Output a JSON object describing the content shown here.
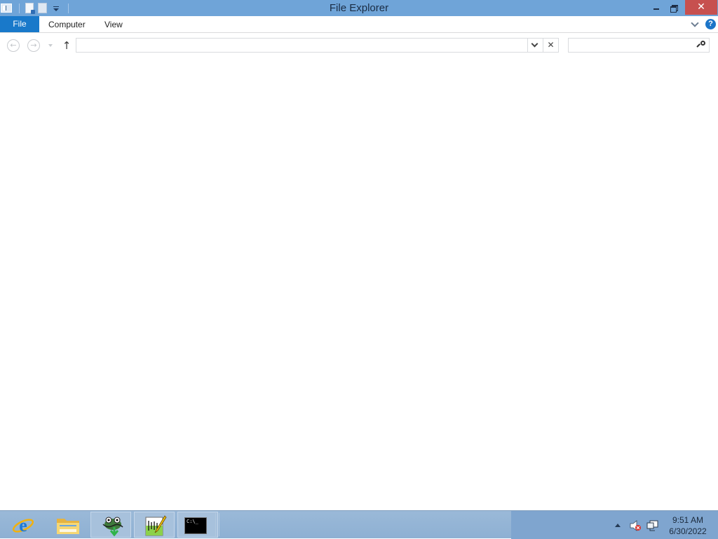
{
  "window": {
    "title": "File Explorer",
    "close_glyph": "✕"
  },
  "ribbon": {
    "tabs": [
      {
        "label": "File"
      },
      {
        "label": "Computer"
      },
      {
        "label": "View"
      }
    ],
    "help_glyph": "?"
  },
  "navigation": {
    "back_glyph": "←",
    "forward_glyph": "→",
    "up_glyph": "↑",
    "address_value": "",
    "clear_glyph": "✕",
    "search_value": "",
    "search_placeholder": ""
  },
  "taskbar": {
    "items": [
      {
        "name": "Internet Explorer",
        "icon": "internet-explorer-icon",
        "state": "pinned"
      },
      {
        "name": "File Explorer",
        "icon": "file-explorer-icon",
        "state": "pinned"
      },
      {
        "name": "Wireshark",
        "icon": "wireshark-icon",
        "state": "running"
      },
      {
        "name": "Notepad++",
        "icon": "notepad-icon",
        "state": "running"
      },
      {
        "name": "Command Prompt",
        "icon": "command-prompt-icon",
        "state": "running",
        "icon_text": "C:\\_"
      }
    ],
    "tray": {
      "time": "9:51 AM",
      "date": "6/30/2022"
    }
  },
  "colors": {
    "titlebar": "#6fa4d8",
    "file_tab": "#1979ca",
    "close_button": "#c7504f",
    "taskbar": "#8eb0d3"
  }
}
